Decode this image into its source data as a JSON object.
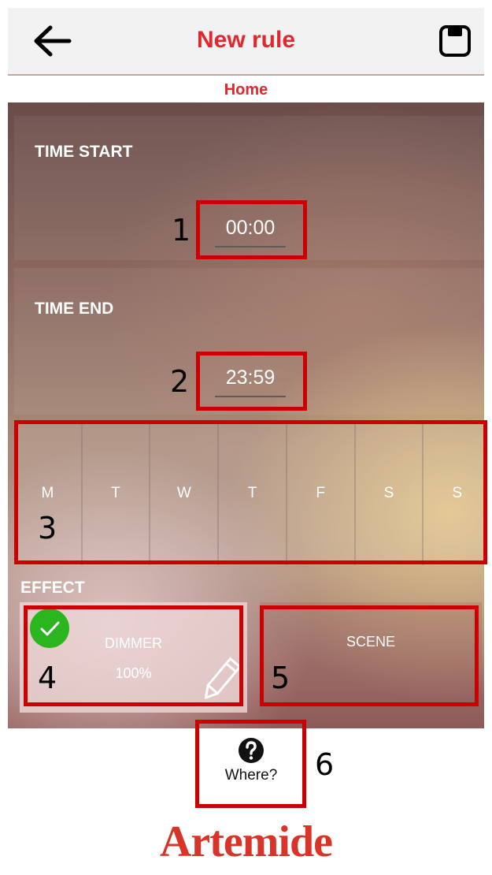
{
  "header": {
    "title": "New rule",
    "back_icon": "arrow-left-icon",
    "save_icon": "floppy-disk-icon",
    "accent_color": "#e0282e"
  },
  "subtitle": "Home",
  "time_start": {
    "label": "TIME START",
    "value": "00:00"
  },
  "time_end": {
    "label": "TIME END",
    "value": "23:59"
  },
  "days": [
    "M",
    "T",
    "W",
    "T",
    "F",
    "S",
    "S"
  ],
  "effect": {
    "label": "EFFECT",
    "dimmer": {
      "title": "DIMMER",
      "value": "100%",
      "selected": true,
      "check_icon": "check-circle-icon",
      "edit_icon": "pencil-icon"
    },
    "scene": {
      "title": "SCENE"
    }
  },
  "where": {
    "label": "Where?",
    "icon": "question-circle-icon"
  },
  "logo": "Artemide",
  "annotations": [
    "1",
    "2",
    "3",
    "4",
    "5",
    "6"
  ],
  "annotation_color": "#cc0000"
}
